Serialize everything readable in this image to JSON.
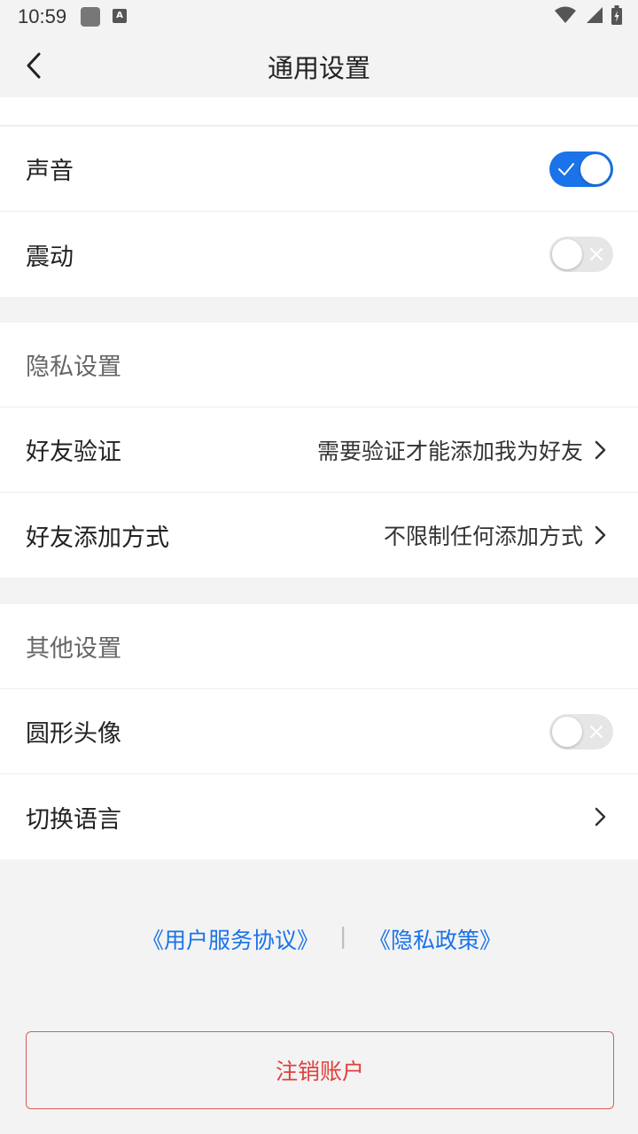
{
  "status_bar": {
    "time": "10:59",
    "icon_b_letter": "A"
  },
  "nav": {
    "title": "通用设置"
  },
  "notifications": [
    {
      "label": "声音",
      "toggle": "on"
    },
    {
      "label": "震动",
      "toggle": "off"
    }
  ],
  "privacy": {
    "section_label": "隐私设置",
    "friend_verify": {
      "label": "好友验证",
      "value": "需要验证才能添加我为好友"
    },
    "friend_add_method": {
      "label": "好友添加方式",
      "value": "不限制任何添加方式"
    }
  },
  "other": {
    "section_label": "其他设置",
    "round_avatar": {
      "label": "圆形头像",
      "toggle": "off"
    },
    "switch_language": {
      "label": "切换语言"
    }
  },
  "links": {
    "user_agreement": "《用户服务协议》",
    "separator": "|",
    "privacy_policy": "《隐私政策》"
  },
  "logout_label": "注销账户",
  "colors": {
    "accent": "#1a73e8",
    "danger": "#e0403c",
    "background": "#f3f3f3"
  }
}
